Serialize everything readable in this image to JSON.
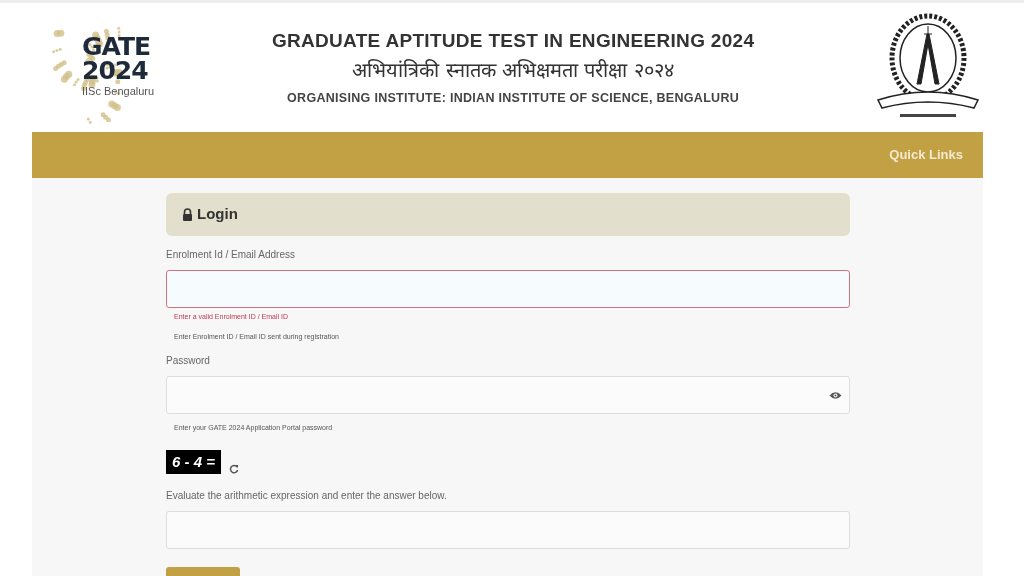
{
  "header": {
    "logo": {
      "line_1": "GATE",
      "line_2": "2024",
      "caption": "IISc Bengaluru"
    },
    "title": "GRADUATE APTITUDE TEST IN ENGINEERING 2024",
    "title_hindi": "अभियांत्रिकी स्नातक अभिक्षमता परीक्षा २०२४",
    "organiser": "ORGANISING INSTITUTE: INDIAN INSTITUTE OF SCIENCE, BENGALURU"
  },
  "navbar": {
    "links": [
      "Quick Links"
    ]
  },
  "login": {
    "heading": "Login",
    "fields": [
      {
        "label": "Enrolment Id / Email Address",
        "invalid": true,
        "error": "Enter a valid Enrolment ID / Email ID",
        "help": "Enter Enrolment ID / Email ID sent during registration",
        "kind": "text"
      },
      {
        "label": "Password",
        "invalid": false,
        "help": "Enter your GATE 2024 Application Portal password",
        "kind": "password"
      }
    ],
    "captcha": {
      "expression": "6 - 4 =",
      "instruction": "Evaluate the arithmetic expression and enter the answer below."
    }
  }
}
